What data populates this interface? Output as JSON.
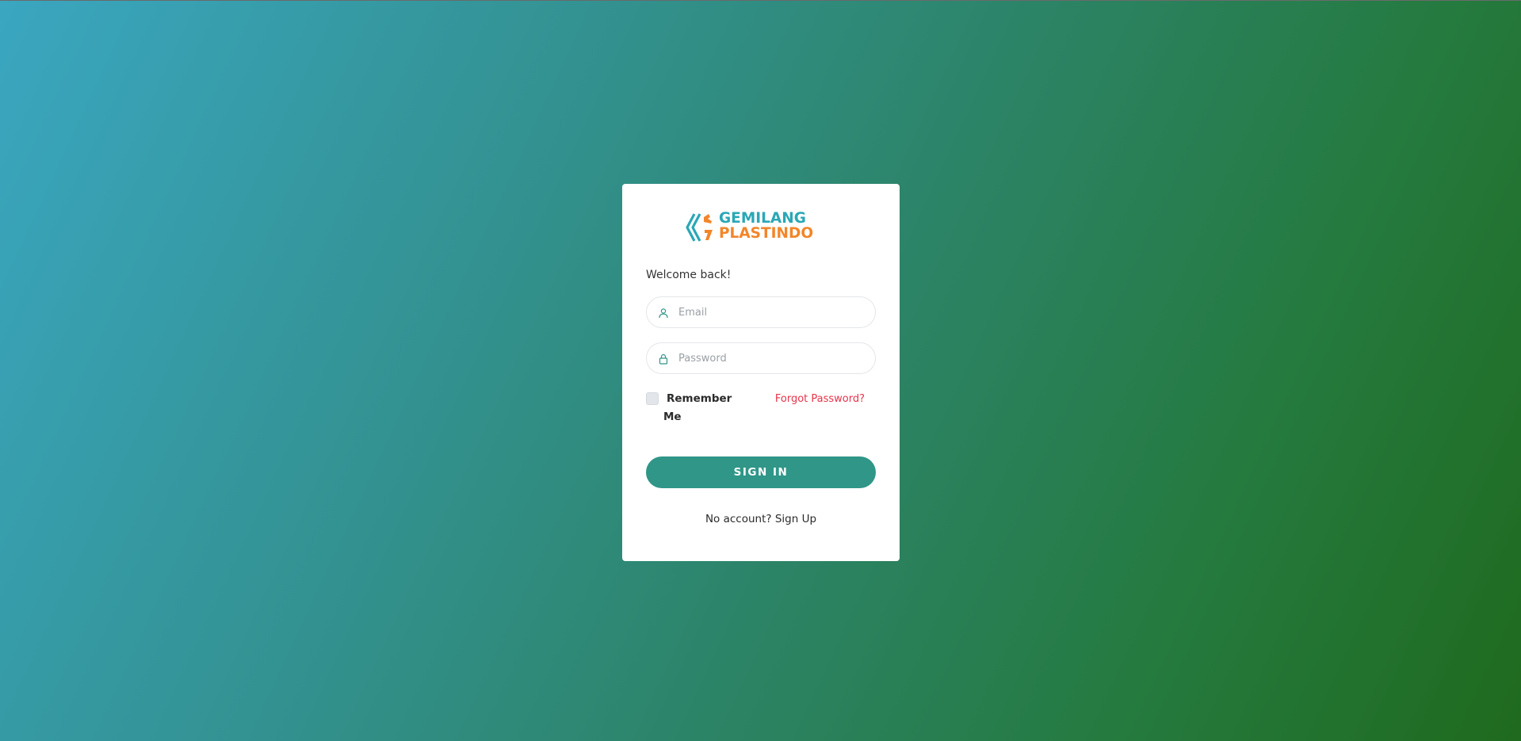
{
  "brand": {
    "name_line1": "GEMILANG",
    "name_line2": "PLASTINDO",
    "primary_color": "#2aa7b6",
    "secondary_color": "#f2862a"
  },
  "login": {
    "welcome_text": "Welcome back!",
    "email_placeholder": "Email",
    "email_value": "",
    "email_icon": "user-icon",
    "password_placeholder": "Password",
    "password_value": "",
    "password_icon": "lock-icon",
    "remember_label": "Remember Me",
    "remember_checked": false,
    "forgot_password_label": "Forgot Password?",
    "sign_in_label": "SIGN IN",
    "no_account_text": "No account?",
    "sign_up_label": "Sign Up"
  },
  "colors": {
    "accent": "#2f9688",
    "link_red": "#e8334a",
    "background_start": "#3aa6c0",
    "background_end": "#1f6a1e"
  }
}
